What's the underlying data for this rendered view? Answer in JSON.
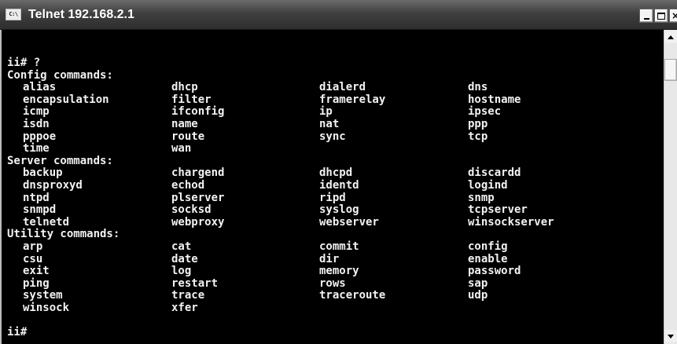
{
  "window": {
    "title": "Telnet 192.168.2.1",
    "system_icon": "console-window-icon",
    "system_icon_text": "C:\\",
    "controls": [
      "minimize-icon",
      "maximize-icon",
      "close-icon"
    ]
  },
  "console": {
    "lines": [
      {
        "type": "prompt",
        "text": "ii# ?"
      },
      {
        "type": "header",
        "text": "Config commands:"
      },
      {
        "type": "row",
        "cells": [
          "alias",
          "dhcp",
          "dialerd",
          "dns"
        ]
      },
      {
        "type": "row",
        "cells": [
          "encapsulation",
          "filter",
          "framerelay",
          "hostname"
        ]
      },
      {
        "type": "row",
        "cells": [
          "icmp",
          "ifconfig",
          "ip",
          "ipsec"
        ]
      },
      {
        "type": "row",
        "cells": [
          "isdn",
          "name",
          "nat",
          "ppp"
        ]
      },
      {
        "type": "row",
        "cells": [
          "pppoe",
          "route",
          "sync",
          "tcp"
        ]
      },
      {
        "type": "row",
        "cells": [
          "time",
          "wan",
          "",
          ""
        ]
      },
      {
        "type": "header",
        "text": "Server commands:"
      },
      {
        "type": "row",
        "cells": [
          "backup",
          "chargend",
          "dhcpd",
          "discardd"
        ]
      },
      {
        "type": "row",
        "cells": [
          "dnsproxyd",
          "echod",
          "identd",
          "logind"
        ]
      },
      {
        "type": "row",
        "cells": [
          "ntpd",
          "plserver",
          "ripd",
          "snmp"
        ]
      },
      {
        "type": "row",
        "cells": [
          "snmpd",
          "socksd",
          "syslog",
          "tcpserver"
        ]
      },
      {
        "type": "row",
        "cells": [
          "telnetd",
          "webproxy",
          "webserver",
          "winsockserver"
        ]
      },
      {
        "type": "header",
        "text": "Utility commands:"
      },
      {
        "type": "row",
        "cells": [
          "arp",
          "cat",
          "commit",
          "config"
        ]
      },
      {
        "type": "row",
        "cells": [
          "csu",
          "date",
          "dir",
          "enable"
        ]
      },
      {
        "type": "row",
        "cells": [
          "exit",
          "log",
          "memory",
          "password"
        ]
      },
      {
        "type": "row",
        "cells": [
          "ping",
          "restart",
          "rows",
          "sap"
        ]
      },
      {
        "type": "row",
        "cells": [
          "system",
          "trace",
          "traceroute",
          "udp"
        ]
      },
      {
        "type": "row",
        "cells": [
          "winsock",
          "xfer",
          "",
          ""
        ]
      },
      {
        "type": "blank",
        "text": ""
      },
      {
        "type": "prompt",
        "text": "ii#"
      }
    ]
  },
  "scrollbar": {
    "up": "scroll-up-arrow-icon",
    "down": "scroll-down-arrow-icon"
  },
  "colors": {
    "console_background": "#000000",
    "console_text": "#f2f2f2",
    "titlebar": "#3f3f3f",
    "title_text": "#ffffff"
  }
}
